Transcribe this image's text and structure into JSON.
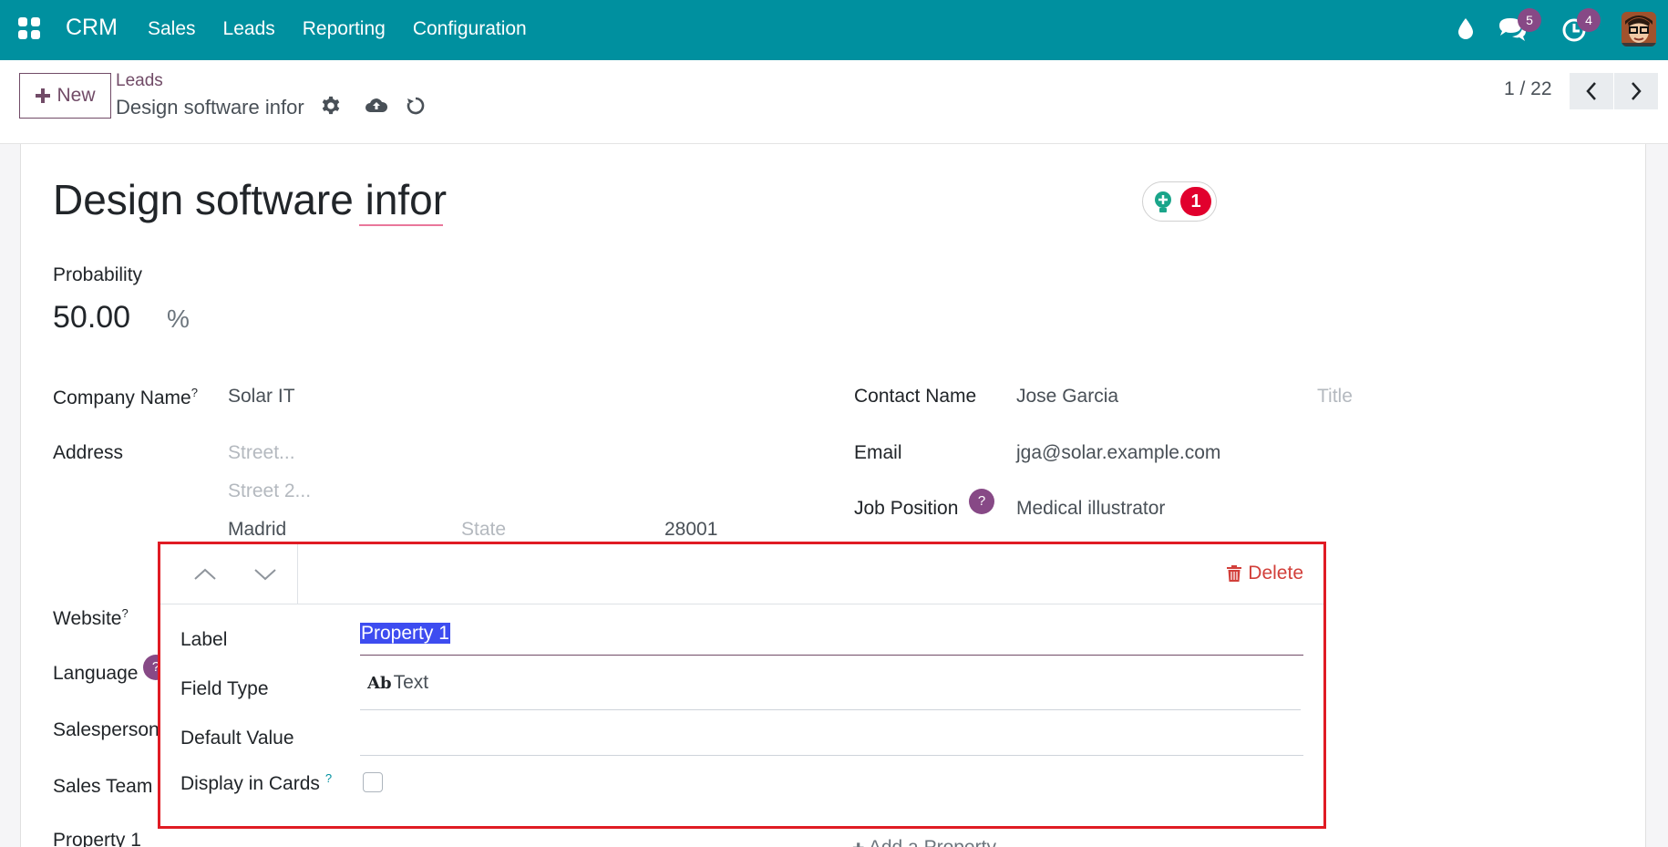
{
  "navbar": {
    "brand": "CRM",
    "menu": [
      "Sales",
      "Leads",
      "Reporting",
      "Configuration"
    ],
    "messages_count": "5",
    "activities_count": "4"
  },
  "control": {
    "new_label": "New",
    "breadcrumb": "Leads",
    "current": "Design software infor",
    "pager": "1 / 22"
  },
  "record": {
    "title": "Design software infor",
    "ai_count": "1",
    "probability_label": "Probability",
    "probability_value": "50.00",
    "probability_unit": "%",
    "company_label": "Company Name",
    "company_value": "Solar IT",
    "address_label": "Address",
    "street_placeholder": "Street...",
    "street2_placeholder": "Street 2...",
    "city": "Madrid",
    "state_placeholder": "State",
    "zip": "28001",
    "website_label": "Website",
    "language_label": "Language",
    "salesperson_label": "Salesperson",
    "salesteam_label": "Sales Team",
    "property_label": "Property 1",
    "contact_label": "Contact Name",
    "contact_value": "Jose Garcia",
    "title_placeholder": "Title",
    "email_label": "Email",
    "email_value": "jga@solar.example.com",
    "job_label": "Job Position",
    "job_value": "Medical illustrator",
    "add_property": "Add a Property",
    "help_mark": "?"
  },
  "popover": {
    "delete_label": "Delete",
    "label_label": "Label",
    "label_value": "Property 1",
    "field_type_label": "Field Type",
    "field_type_icon": "Ab",
    "field_type_value": "Text",
    "default_value_label": "Default Value",
    "display_cards_label": "Display in Cards"
  }
}
